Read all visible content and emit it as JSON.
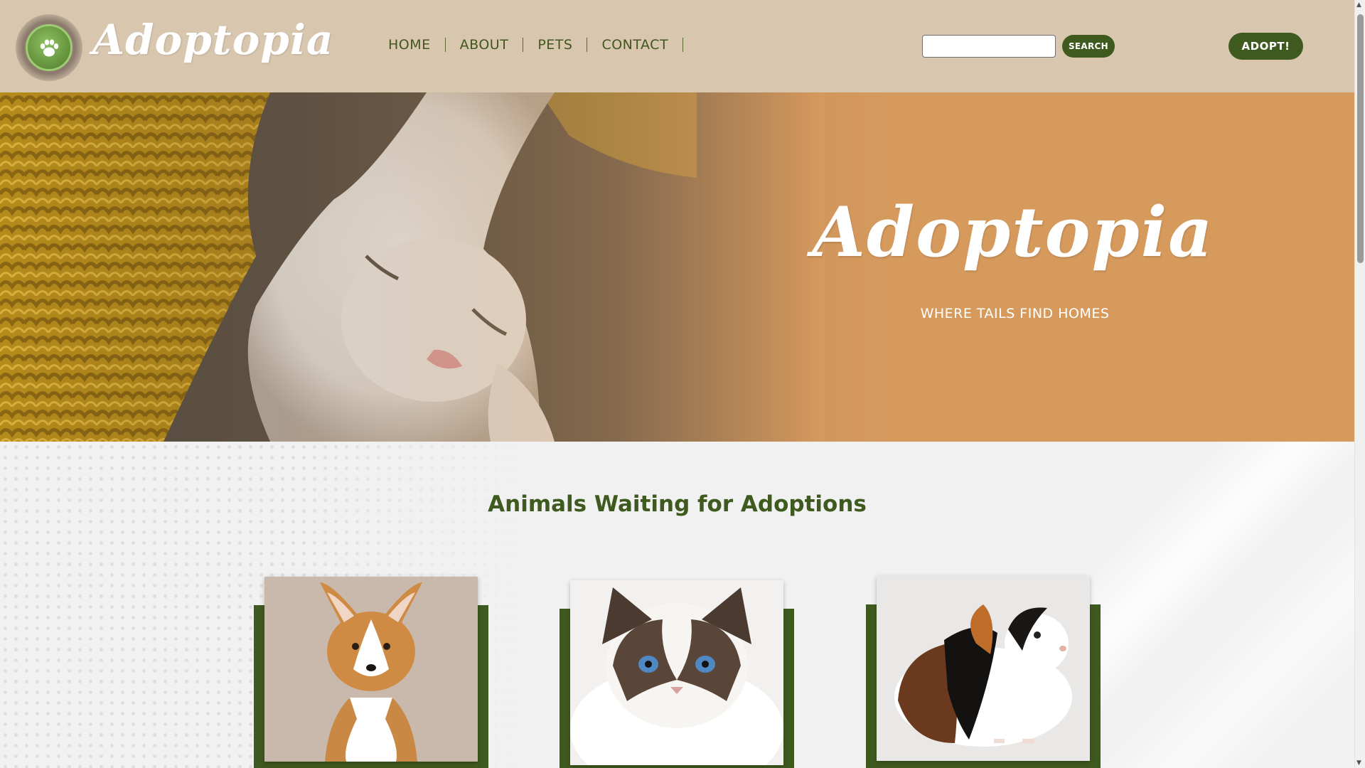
{
  "header": {
    "brand": "Adoptopia",
    "logo_icon": "paw-icon",
    "nav": [
      {
        "label": "HOME"
      },
      {
        "label": "ABOUT"
      },
      {
        "label": "PETS"
      },
      {
        "label": "CONTACT"
      }
    ],
    "search": {
      "value": "",
      "placeholder": "",
      "button_label": "SEARCH"
    },
    "cta_label": "ADOPT!"
  },
  "hero": {
    "title": "Adoptopia",
    "subtitle": "WHERE TAILS FIND HOMES"
  },
  "listings": {
    "title": "Animals Waiting for Adoptions",
    "cards": [
      {
        "animal": "corgi-puppy-photo"
      },
      {
        "animal": "ragdoll-cat-photo"
      },
      {
        "animal": "guinea-pig-photo"
      }
    ]
  },
  "colors": {
    "accent_green": "#3f5a1f",
    "header_bg": "#d8c6ae",
    "hero_orange": "#d69a5d",
    "text_green": "#42561f"
  }
}
